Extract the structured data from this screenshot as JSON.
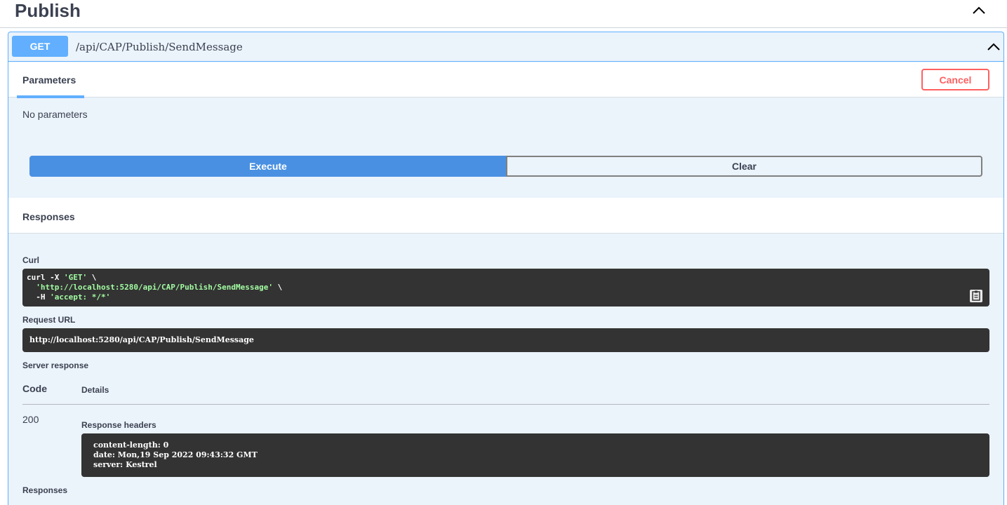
{
  "tag": {
    "title": "Publish",
    "chevron_icon": "chevron-up-icon"
  },
  "operation": {
    "method": "GET",
    "path": "/api/CAP/Publish/SendMessage",
    "chevron_icon": "chevron-up-icon"
  },
  "parameters": {
    "tab_label": "Parameters",
    "cancel_label": "Cancel",
    "empty_text": "No parameters"
  },
  "actions": {
    "execute_label": "Execute",
    "clear_label": "Clear"
  },
  "responses": {
    "title": "Responses",
    "curl_label": "Curl",
    "curl_lines": [
      {
        "prefix": "curl -X ",
        "str": "'GET'",
        "suffix": " \\"
      },
      {
        "prefix": "  ",
        "str": "'http://localhost:5280/api/CAP/Publish/SendMessage'",
        "suffix": " \\"
      },
      {
        "prefix": "  -H ",
        "str": "'accept: */*'",
        "suffix": ""
      }
    ],
    "request_url_label": "Request URL",
    "request_url": "http://localhost:5280/api/CAP/Publish/SendMessage",
    "server_response_label": "Server response",
    "col_code": "Code",
    "col_details": "Details",
    "code": "200",
    "response_headers_label": "Response headers",
    "headers": [
      "content-length: 0",
      "date: Mon,19 Sep 2022 09:43:32 GMT",
      "server: Kestrel"
    ],
    "bottom_label": "Responses"
  },
  "colors": {
    "get_accent": "#61affe",
    "execute_blue": "#4990e2",
    "cancel_red": "#ff6060",
    "code_bg": "#333333",
    "curl_string": "#a2fca2"
  }
}
